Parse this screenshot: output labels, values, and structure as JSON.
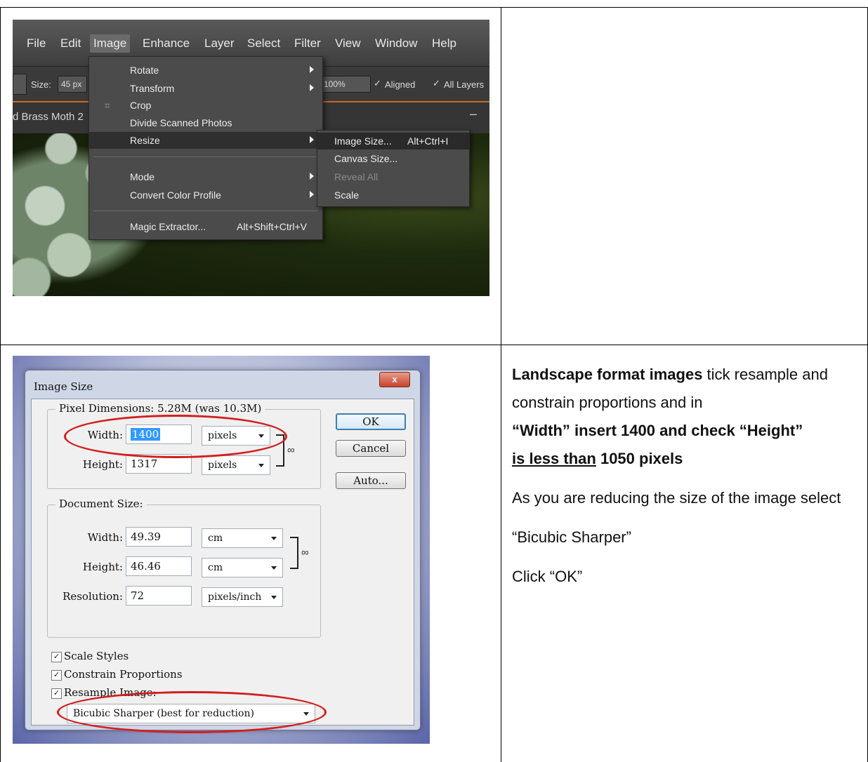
{
  "menu_screenshot": {
    "menubar": [
      "File",
      "Edit",
      "Image",
      "Enhance",
      "Layer",
      "Select",
      "Filter",
      "View",
      "Window",
      "Help"
    ],
    "active_menu": "Image",
    "options_bar": {
      "size_label": "Size:",
      "size_value": "45 px",
      "opacity_value": "100%",
      "aligned_label": "Aligned",
      "all_layers_label": "All Layers"
    },
    "document_tab": "d Brass Moth 2",
    "image_menu": {
      "items": [
        {
          "label": "Rotate",
          "submenu": true
        },
        {
          "label": "Transform",
          "submenu": true
        },
        {
          "label": "Crop",
          "submenu": false
        },
        {
          "label": "Divide Scanned Photos",
          "submenu": false
        },
        {
          "label": "Resize",
          "submenu": true
        },
        {
          "label": "Mode",
          "submenu": true
        },
        {
          "label": "Convert Color Profile",
          "submenu": true
        },
        {
          "label": "Magic Extractor...",
          "shortcut": "Alt+Shift+Ctrl+V"
        }
      ]
    },
    "resize_submenu": {
      "items": [
        {
          "label": "Image Size...",
          "shortcut": "Alt+Ctrl+I"
        },
        {
          "label": "Canvas Size..."
        },
        {
          "label": "Reveal All"
        },
        {
          "label": "Scale"
        }
      ]
    }
  },
  "dialog_screenshot": {
    "title": "Image Size",
    "close_label": "x",
    "pixel_dimensions": {
      "group_title": "Pixel Dimensions:  5.28M (was 10.3M)",
      "width_label": "Width:",
      "width_value": "1400",
      "width_unit": "pixels",
      "height_label": "Height:",
      "height_value": "1317",
      "height_unit": "pixels"
    },
    "document_size": {
      "group_title": "Document Size:",
      "width_label": "Width:",
      "width_value": "49.39",
      "width_unit": "cm",
      "height_label": "Height:",
      "height_value": "46.46",
      "height_unit": "cm",
      "resolution_label": "Resolution:",
      "resolution_value": "72",
      "resolution_unit": "pixels/inch"
    },
    "buttons": {
      "ok": "OK",
      "cancel": "Cancel",
      "auto": "Auto..."
    },
    "checkboxes": {
      "scale_styles": "Scale Styles",
      "constrain": "Constrain Proportions",
      "resample": "Resample Image:"
    },
    "resample_method": "Bicubic Sharper (best for reduction)"
  },
  "instructions": {
    "p1_bold": "Landscape format images",
    "p1_text": " tick resample and constrain proportions and in",
    "p2_bold": "“Width” insert 1400 and check “Height”",
    "p3_underline": "is less than",
    "p3_bold": " 1050 pixels",
    "p4": "As you are reducing the size of the image select",
    "p5": "“Bicubic Sharper”",
    "p6": "Click “OK”"
  }
}
